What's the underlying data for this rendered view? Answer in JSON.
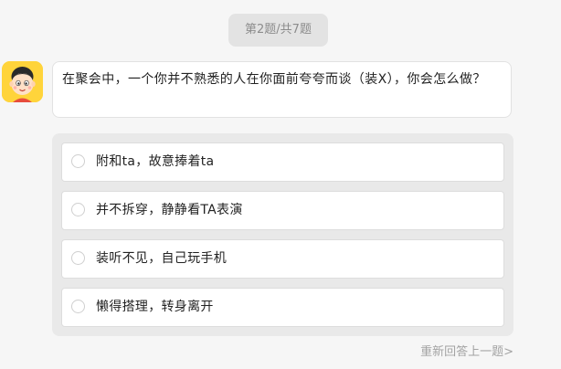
{
  "progress": {
    "label": "第2题/共7题"
  },
  "question": {
    "text": "在聚会中，一个你并不熟悉的人在你面前夸夸而谈（装X），你会怎么做？"
  },
  "options": [
    {
      "label": "附和ta，故意捧着ta"
    },
    {
      "label": "并不拆穿，静静看TA表演"
    },
    {
      "label": "装听不见，自己玩手机"
    },
    {
      "label": "懒得搭理，转身离开"
    }
  ],
  "footer": {
    "redo_label": "重新回答上一题>"
  },
  "colors": {
    "avatar_bg": "#ffd43b",
    "page_bg": "#f6f6f6"
  },
  "icons": {
    "avatar": "cartoon-boy-avatar",
    "radio": "radio-circle-icon"
  }
}
